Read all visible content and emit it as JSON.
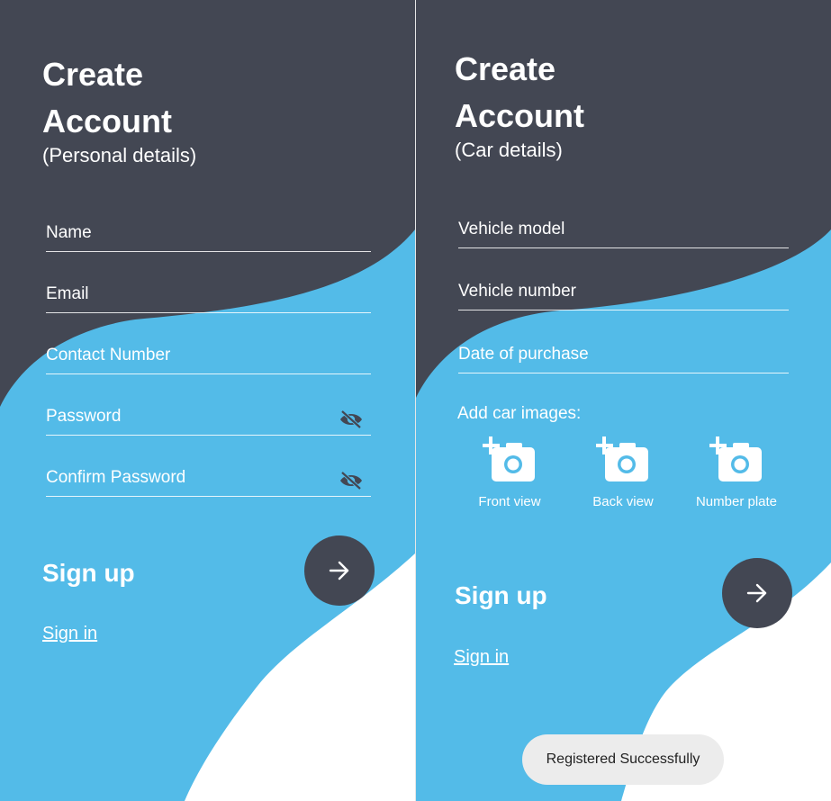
{
  "colors": {
    "dark": "#434753",
    "blue": "#53bbe8",
    "white": "#ffffff"
  },
  "personal_screen": {
    "title_line1": "Create",
    "title_line2": "Account",
    "subtitle": "(Personal details)",
    "fields": {
      "name": "Name",
      "email": "Email",
      "contact": "Contact Number",
      "password": "Password",
      "confirm_password": "Confirm Password"
    },
    "password_toggle_icon": "eye-off-icon",
    "signup_label": "Sign up",
    "next_icon": "arrow-right-icon",
    "signin_label": "Sign in"
  },
  "car_screen": {
    "title_line1": "Create",
    "title_line2": "Account",
    "subtitle": "(Car details)",
    "fields": {
      "vehicle_model": "Vehicle model",
      "vehicle_number": "Vehicle number",
      "date_of_purchase": "Date of purchase"
    },
    "add_images_label": "Add car images:",
    "image_slots": [
      "Front view",
      "Back view",
      "Number plate"
    ],
    "image_slot_icon": "add-photo-icon",
    "signup_label": "Sign up",
    "next_icon": "arrow-right-icon",
    "signin_label": "Sign in",
    "toast": "Registered Successfully"
  }
}
